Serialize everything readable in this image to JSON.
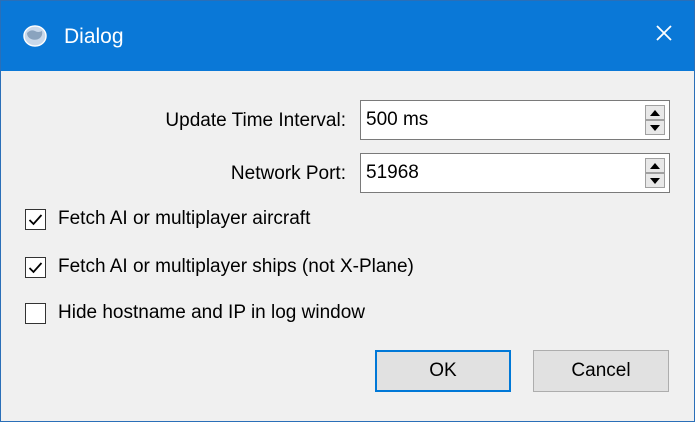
{
  "window": {
    "title": "Dialog",
    "icon": "globe-icon",
    "close": "close-icon",
    "accent": "#0a78d7"
  },
  "fields": {
    "update_interval": {
      "label": "Update Time Interval:",
      "value": "500 ms"
    },
    "network_port": {
      "label": "Network Port:",
      "value": "51968"
    }
  },
  "options": [
    {
      "label": "Fetch AI or multiplayer aircraft",
      "checked": true
    },
    {
      "label": "Fetch AI or multiplayer ships (not X-Plane)",
      "checked": true
    },
    {
      "label": "Hide hostname and IP in log window",
      "checked": false
    }
  ],
  "buttons": {
    "ok": "OK",
    "cancel": "Cancel"
  }
}
